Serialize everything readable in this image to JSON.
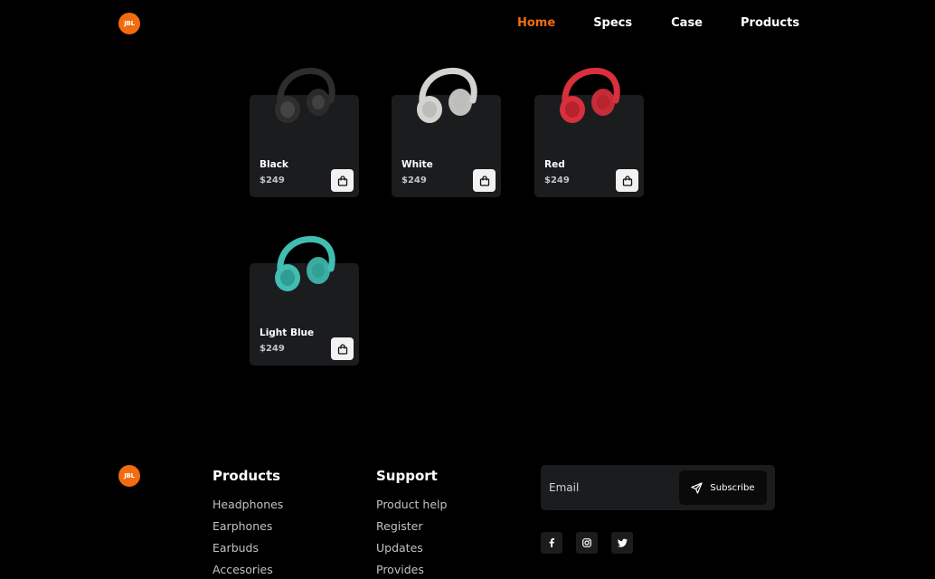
{
  "brand": {
    "logo_text": "JBL",
    "accent": "#f26b0f"
  },
  "nav": {
    "items": [
      {
        "label": "Home",
        "active": true
      },
      {
        "label": "Specs",
        "active": false
      },
      {
        "label": "Case",
        "active": false
      },
      {
        "label": "Products",
        "active": false
      }
    ]
  },
  "products": [
    {
      "name": "Black",
      "price": "$249",
      "color": "#2e2e2e"
    },
    {
      "name": "White",
      "price": "$249",
      "color": "#d3d3cf"
    },
    {
      "name": "Red",
      "price": "$249",
      "color": "#d8303c"
    },
    {
      "name": "Light Blue",
      "price": "$249",
      "color": "#41bdb2"
    }
  ],
  "footer": {
    "products": {
      "title": "Products",
      "links": [
        "Headphones",
        "Earphones",
        "Earbuds",
        "Accesories"
      ]
    },
    "support": {
      "title": "Support",
      "links": [
        "Product help",
        "Register",
        "Updates",
        "Provides"
      ]
    },
    "subscribe": {
      "placeholder": "Email",
      "button_label": "Subscribe"
    },
    "social": [
      "facebook-icon",
      "instagram-icon",
      "twitter-icon"
    ]
  }
}
